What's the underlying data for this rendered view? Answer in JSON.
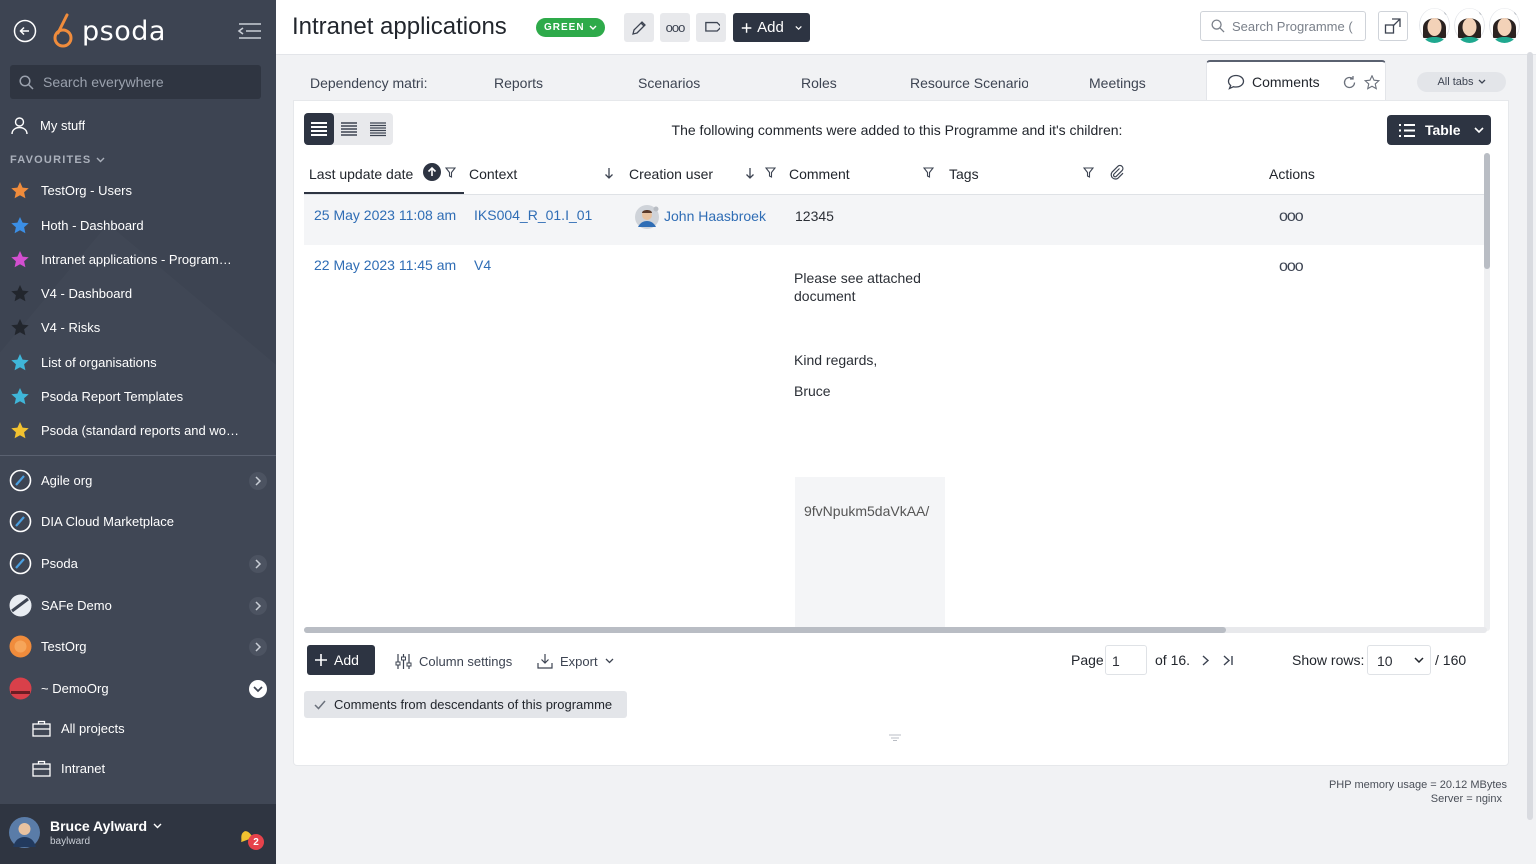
{
  "sidebar": {
    "logo_text": "psoda",
    "search_placeholder": "Search everywhere",
    "my_stuff": "My stuff",
    "favourites_header": "FAVOURITES",
    "favourites": [
      {
        "label": "TestOrg - Users",
        "color": "#f08c3c"
      },
      {
        "label": "Hoth - Dashboard",
        "color": "#3b8fe6"
      },
      {
        "label": "Intranet applications - Programme...",
        "color": "#d34fd0"
      },
      {
        "label": "V4 - Dashboard",
        "color": "#2a2f38"
      },
      {
        "label": "V4 - Risks",
        "color": "#2a2f38"
      },
      {
        "label": "List of organisations",
        "color": "#3fb6d9"
      },
      {
        "label": "Psoda Report Templates",
        "color": "#3fb6d9"
      },
      {
        "label": "Psoda (standard reports and work...",
        "color": "#f2c230"
      }
    ],
    "orgs": [
      {
        "label": "Agile org"
      },
      {
        "label": "DIA Cloud Marketplace"
      },
      {
        "label": "Psoda"
      },
      {
        "label": "SAFe Demo"
      },
      {
        "label": "TestOrg"
      },
      {
        "label": "~ DemoOrg"
      }
    ],
    "sub_items": [
      {
        "label": "All projects"
      },
      {
        "label": "Intranet"
      }
    ],
    "user": {
      "name": "Bruce Aylward",
      "login": "baylward",
      "notifications": "2"
    }
  },
  "header": {
    "title": "Intranet applications",
    "status": "GREEN",
    "add_label": "Add",
    "search_placeholder": "Search Programme (",
    "accent": "#2d3442",
    "status_color": "#2eaa4a"
  },
  "tabs": {
    "items": [
      "Dependency matri:",
      "Reports",
      "Scenarios",
      "Roles",
      "Resource Scenario:",
      "Meetings"
    ],
    "active": "Comments",
    "all_tabs": "All tabs"
  },
  "panel": {
    "info_text": "The following comments were added to this Programme and it's children:",
    "view_mode": "Table",
    "columns": [
      "Last update date",
      "Context",
      "Creation user",
      "Comment",
      "Tags",
      "Actions"
    ],
    "rows": [
      {
        "date": "25 May 2023 11:08 am",
        "context": "IKS004_R_01.I_01",
        "user": "John Haasbroek",
        "comment": [
          "12345"
        ]
      },
      {
        "date": "22 May 2023 11:45 am",
        "context": "V4",
        "user": "",
        "comment": [
          "Please see attached",
          "document",
          "Kind regards,",
          "Bruce"
        ],
        "image_alt": "9fvNpukm5daVkAA/"
      }
    ],
    "footer": {
      "add_label": "Add",
      "column_settings": "Column settings",
      "export": "Export",
      "page_label": "Page",
      "page_value": "1",
      "of_pages": "of 16.",
      "show_rows_label": "Show rows:",
      "rows_value": "10",
      "total": "/ 160"
    },
    "filter_chip": "Comments from descendants of this programme"
  },
  "server_info": {
    "memory": "PHP memory usage = 20.12 MBytes",
    "server": "Server = nginx"
  }
}
